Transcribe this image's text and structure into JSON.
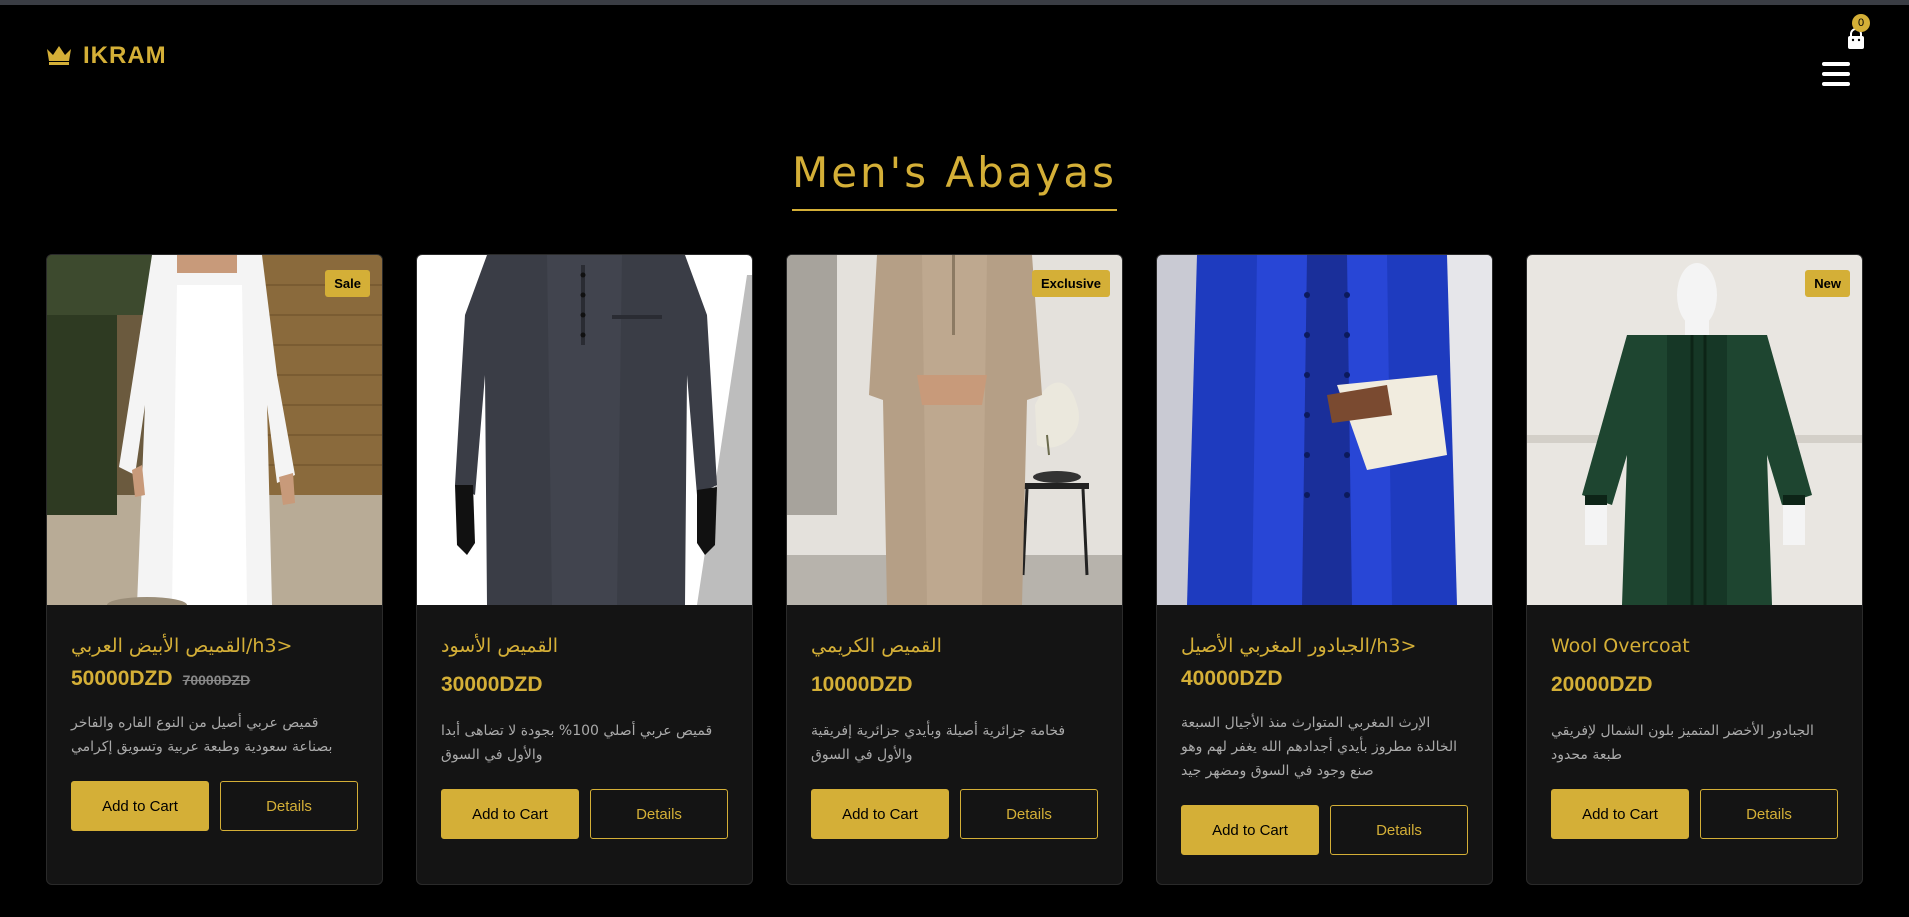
{
  "brand": {
    "name": "IKRAM",
    "icon": "crown-icon"
  },
  "header": {
    "cart_count": "0",
    "cart_icon": "shopping-bag-icon",
    "menu_icon": "hamburger-menu-icon"
  },
  "page": {
    "title": "Men's Abayas"
  },
  "colors": {
    "accent": "#d4af37",
    "background": "#000000",
    "card": "#141414"
  },
  "products": [
    {
      "name": "القميص الأبيض العربي/h3>",
      "price": "50000DZD",
      "old_price": "70000DZD",
      "badge": "Sale",
      "description": "قميص عربي أصيل من النوع الفاره والفاخر بصناعة سعودية وطبعة عربية وتسويق إكرامي",
      "add_label": "Add to Cart",
      "details_label": "Details"
    },
    {
      "name": "القميص الأسود",
      "price": "30000DZD",
      "old_price": "",
      "badge": "",
      "description": "قميص عربي أصلي 100% بجودة لا تضاهى أبدا والأول في السوق",
      "add_label": "Add to Cart",
      "details_label": "Details"
    },
    {
      "name": "القميص الكريمي",
      "price": "10000DZD",
      "old_price": "",
      "badge": "Exclusive",
      "description": "فخامة جزائرية أصيلة وبأيدي جزائرية إفريقية والأول في السوق",
      "add_label": "Add to Cart",
      "details_label": "Details"
    },
    {
      "name": "الجبادور المغربي الأصيل/h3>",
      "price": "40000DZD",
      "old_price": "",
      "badge": "",
      "description": "الإرث المغربي المتوارث منذ الأجيال السبعة الخالدة مطروز بأيدي أجدادهم الله يغفر لهم وهو صنع وجود في السوق ومضهر جيد",
      "add_label": "Add to Cart",
      "details_label": "Details"
    },
    {
      "name": "Wool Overcoat",
      "price": "20000DZD",
      "old_price": "",
      "badge": "New",
      "description": "الجبادور الأخضر المتميز بلون الشمال لإفريقي طبعة محدود",
      "add_label": "Add to Cart",
      "details_label": "Details"
    }
  ]
}
